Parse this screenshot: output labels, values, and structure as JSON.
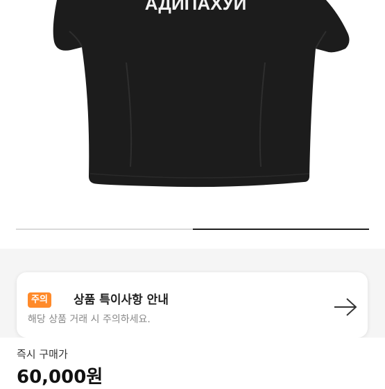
{
  "product": {
    "shirt_print": "АДИПАХУЙ"
  },
  "notice": {
    "badge": "주의",
    "title": "상품 특이사항 안내",
    "description": "해당 상품 거래 시 주의하세요."
  },
  "purchase": {
    "label": "즉시 구매가",
    "price": "60,000원"
  },
  "gallery": {
    "progress": 0.5
  },
  "colors": {
    "badge": "#ff8a2a",
    "shirt": "#1a1a1a"
  }
}
